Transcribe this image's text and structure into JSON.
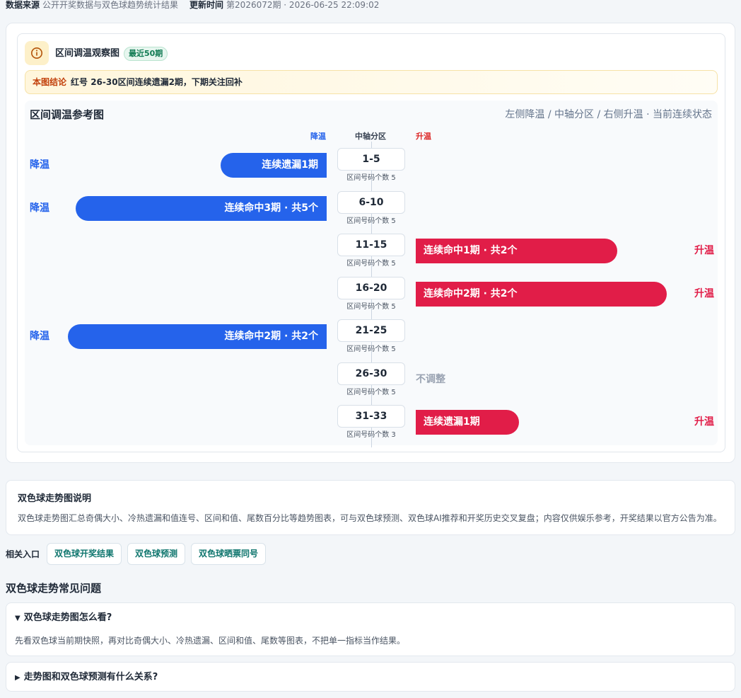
{
  "meta": {
    "source_label": "数据来源",
    "source_value": "公开开奖数据与双色球趋势统计结果",
    "update_label": "更新时间",
    "update_value": "第2026072期 · 2026-06-25 22:09:02"
  },
  "card": {
    "title": "区间调温观察图",
    "badge": "最近50期",
    "conclusion_label": "本图结论",
    "conclusion_text": "红号 26-30区间连续遗漏2期，下期关注回补"
  },
  "chart": {
    "title": "区间调温参考图",
    "subtitle": "左侧降温 / 中轴分区 / 右侧升温 · 当前连续状态",
    "header_cool": "降温",
    "header_center": "中轴分区",
    "header_warm": "升温",
    "count_prefix": "区间号码个数",
    "neutral_label": "不调整",
    "colors": {
      "cool": "#2563eb",
      "warm": "#e11d48",
      "neutral": "#9aa3b2"
    }
  },
  "chart_data": {
    "type": "bar",
    "title": "区间调温参考图",
    "categories": [
      "1-5",
      "6-10",
      "11-15",
      "16-20",
      "21-25",
      "26-30",
      "31-33"
    ],
    "rows": [
      {
        "zone": "1-5",
        "count": 5,
        "direction": "降温",
        "side_label": "降温",
        "bar_text": "连续遗漏1期",
        "magnitude": 0.41
      },
      {
        "zone": "6-10",
        "count": 5,
        "direction": "降温",
        "side_label": "降温",
        "bar_text": "连续命中3期 · 共5个",
        "magnitude": 0.97
      },
      {
        "zone": "11-15",
        "count": 5,
        "direction": "升温",
        "side_label": "升温",
        "bar_text": "连续命中1期 · 共2个",
        "magnitude": 0.78
      },
      {
        "zone": "16-20",
        "count": 5,
        "direction": "升温",
        "side_label": "升温",
        "bar_text": "连续命中2期 · 共2个",
        "magnitude": 0.97
      },
      {
        "zone": "21-25",
        "count": 5,
        "direction": "降温",
        "side_label": "降温",
        "bar_text": "连续命中2期 · 共2个",
        "magnitude": 1.0
      },
      {
        "zone": "26-30",
        "count": 5,
        "direction": "不调整",
        "side_label": "",
        "bar_text": "不调整",
        "magnitude": 0
      },
      {
        "zone": "31-33",
        "count": 3,
        "direction": "升温",
        "side_label": "升温",
        "bar_text": "连续遗漏1期",
        "magnitude": 0.4
      }
    ]
  },
  "description": {
    "title": "双色球走势图说明",
    "text": "双色球走势图汇总奇偶大小、冷热遗漏和值连号、区间和值、尾数百分比等趋势图表，可与双色球预测、双色球AI推荐和开奖历史交叉复盘；内容仅供娱乐参考，开奖结果以官方公告为准。"
  },
  "related": {
    "label": "相关入口",
    "links": [
      "双色球开奖结果",
      "双色球预测",
      "双色球晒票同号"
    ]
  },
  "faq": {
    "title": "双色球走势常见问题",
    "items": [
      {
        "marker": "▼",
        "question": "双色球走势图怎么看?",
        "answer": "先看双色球当前期快照，再对比奇偶大小、冷热遗漏、区间和值、尾数等图表，不把单一指标当作结果。"
      },
      {
        "marker": "▶",
        "question": "走势图和双色球预测有什么关系?",
        "answer": ""
      }
    ]
  }
}
